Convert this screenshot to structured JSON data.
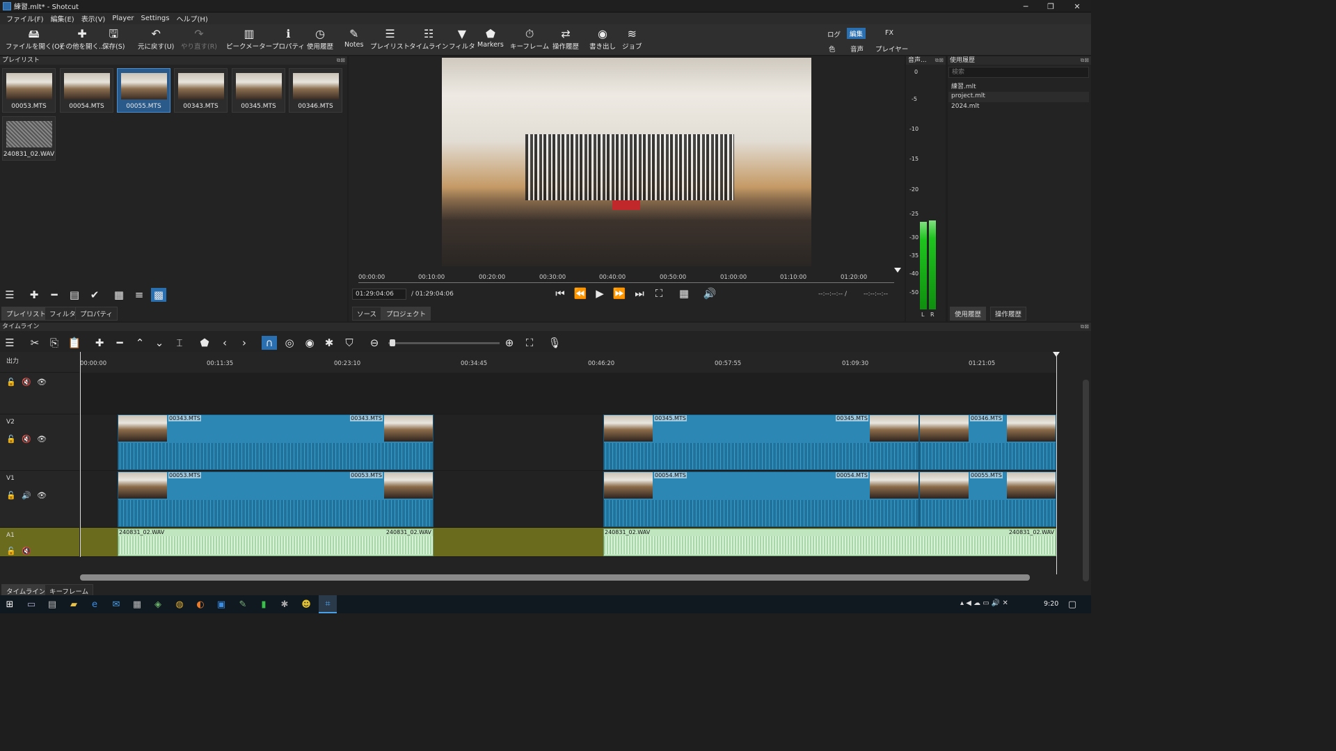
{
  "window": {
    "title": "練習.mlt* - Shotcut",
    "minimize": "─",
    "restore": "❐",
    "close": "✕"
  },
  "menu": [
    "ファイル(F)",
    "編集(E)",
    "表示(V)",
    "Player",
    "Settings",
    "ヘルプ(H)"
  ],
  "toolbar": {
    "open_file": "ファイルを開く(O)",
    "open_other": "その他を開く...",
    "save": "保存(S)",
    "undo": "元に戻す(U)",
    "redo": "やり直す(R)",
    "peak_meter": "ピークメーター",
    "properties": "プロパティ",
    "recent": "使用履歴",
    "notes": "Notes",
    "playlist": "プレイリスト",
    "timeline": "タイムライン",
    "filters": "フィルタ",
    "markers": "Markers",
    "keyframes": "キーフレーム",
    "history": "操作履歴",
    "export": "書き出し",
    "jobs": "ジョブ"
  },
  "layouts": {
    "log": "ログ",
    "edit": "編集",
    "fx": "FX",
    "color": "色",
    "audio": "音声",
    "player": "プレイヤー"
  },
  "playlist": {
    "title": "プレイリスト",
    "items": [
      "00053.MTS",
      "00054.MTS",
      "00055.MTS",
      "00343.MTS",
      "00345.MTS",
      "00346.MTS",
      "240831_02.WAV"
    ],
    "selected_index": 2,
    "tabs": [
      "プレイリスト",
      "フィルタ",
      "プロパティ"
    ]
  },
  "player": {
    "ruler": [
      "00:00:00",
      "00:10:00",
      "00:20:00",
      "00:30:00",
      "00:40:00",
      "00:50:00",
      "01:00:00",
      "01:10:00",
      "01:20:00"
    ],
    "position": "01:29:04:06",
    "duration": "/ 01:29:04:06",
    "in_point": "--:--:--:-- /",
    "out_point": "--:--:--:--",
    "tabs": [
      "ソース",
      "プロジェクト"
    ]
  },
  "audio_meter": {
    "title": "音声...",
    "scale": [
      "0",
      "-5",
      "-10",
      "-15",
      "-20",
      "-25",
      "-30",
      "-35",
      "-40",
      "-50"
    ],
    "left": "L",
    "right": "R"
  },
  "recent": {
    "title": "使用履歴",
    "search_placeholder": "検索",
    "items": [
      "練習.mlt",
      "project.mlt",
      "2024.mlt"
    ],
    "tabs": [
      "使用履歴",
      "操作履歴"
    ]
  },
  "timeline": {
    "title": "タイムライン",
    "output_label": "出力",
    "ruler": [
      "00:00:00",
      "00:11:35",
      "00:23:10",
      "00:34:45",
      "00:46:20",
      "00:57:55",
      "01:09:30",
      "01:21:05"
    ],
    "tracks": [
      "V2",
      "V1",
      "A1"
    ],
    "v2_clips": [
      "00343.MTS",
      "00343.MTS",
      "00345.MTS",
      "00345.MTS",
      "00346.MTS"
    ],
    "v1_clips": [
      "00053.MTS",
      "00053.MTS",
      "00054.MTS",
      "00054.MTS",
      "00055.MTS"
    ],
    "a1_clips": [
      "240831_02.WAV",
      "240831_02.WAV",
      "240831_02.WAV",
      "240831_02.WAV"
    ],
    "tabs": [
      "タイムライン",
      "キーフレーム"
    ]
  },
  "taskbar": {
    "clock": "9:20"
  },
  "colors": {
    "accent": "#2a6fb0",
    "clip_video": "#2c87b5",
    "clip_audio": "#bfe6bf",
    "audio_track_bg": "#6b6b1e",
    "meter_green": "#1fc41f"
  }
}
